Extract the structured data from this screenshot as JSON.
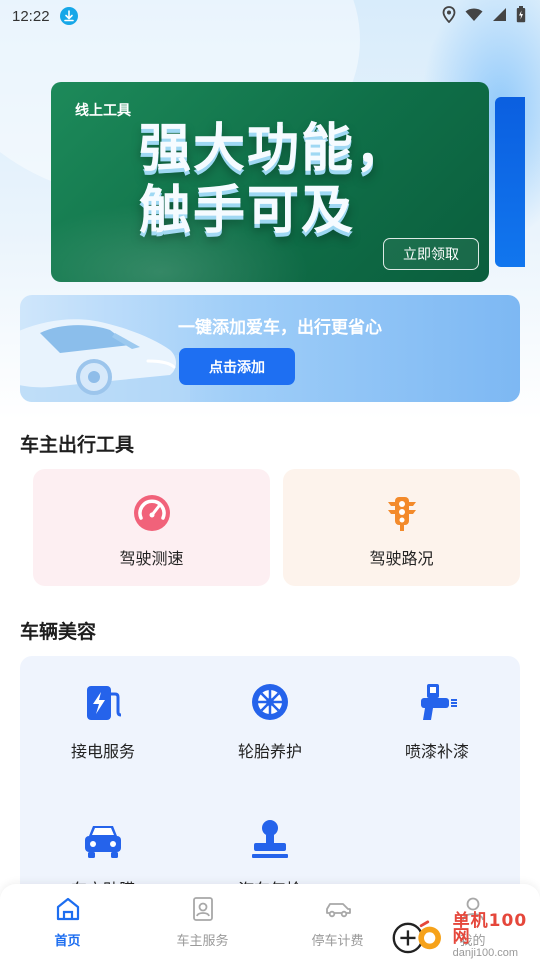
{
  "status_bar": {
    "time": "12:22",
    "icons": [
      "download-icon",
      "location-icon",
      "wifi-icon",
      "signal-icon",
      "battery-icon"
    ]
  },
  "banner": {
    "tag": "线上工具",
    "title": "强大功能，\n触手可及",
    "button_label": "立即领取",
    "colors": {
      "background": "#13784f",
      "peek": "#0b5fe0"
    }
  },
  "add_car": {
    "text": "一键添加爱车，出行更省心",
    "button_label": "点击添加"
  },
  "tools_section": {
    "title": "车主出行工具",
    "items": [
      {
        "label": "驾驶测速",
        "icon": "speedometer-icon",
        "bg": "#fdeff2",
        "color": "#f1627a"
      },
      {
        "label": "驾驶路况",
        "icon": "traffic-light-icon",
        "bg": "#fdf3ec",
        "color": "#f38a2b"
      }
    ]
  },
  "beauty_section": {
    "title": "车辆美容",
    "items": [
      {
        "label": "接电服务",
        "icon": "ev-charger-icon"
      },
      {
        "label": "轮胎养护",
        "icon": "tire-icon"
      },
      {
        "label": "喷漆补漆",
        "icon": "spray-gun-icon"
      },
      {
        "label": "车衣贴膜",
        "icon": "car-front-icon"
      },
      {
        "label": "汽车年检",
        "icon": "stamp-icon"
      }
    ],
    "accent": "#2563eb"
  },
  "tab_bar": {
    "tabs": [
      {
        "label": "首页",
        "icon": "home-icon",
        "active": true
      },
      {
        "label": "车主服务",
        "icon": "owner-card-icon",
        "active": false
      },
      {
        "label": "停车计费",
        "icon": "car-outline-icon",
        "active": false
      },
      {
        "label": "我的",
        "icon": "profile-icon",
        "active": false
      }
    ],
    "active_color": "#1d6ef0"
  },
  "watermark": {
    "main": "单机100网",
    "sub": "danji100.com"
  }
}
